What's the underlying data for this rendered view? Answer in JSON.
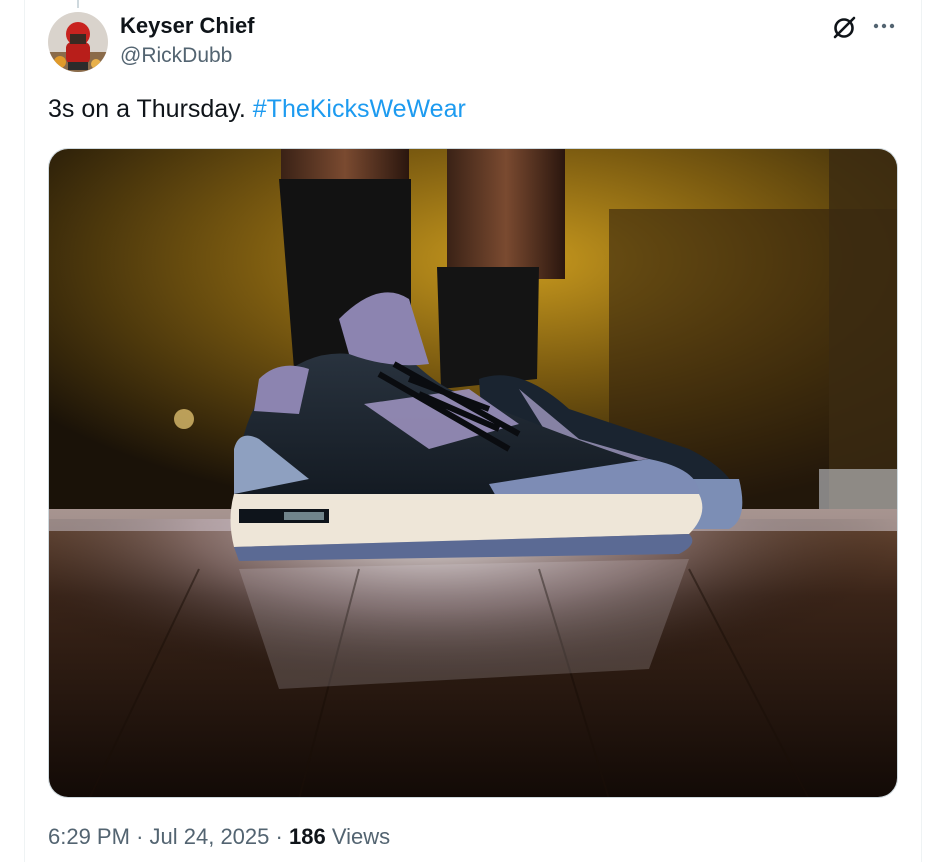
{
  "author": {
    "display_name": "Keyser Chief",
    "handle": "@RickDubb",
    "avatar_icon": "user-avatar"
  },
  "header_actions": {
    "grok_icon": "grok-icon",
    "more_icon": "more-options-icon"
  },
  "tweet": {
    "text": "3s on a Thursday.",
    "hashtag": "#TheKicksWeWear"
  },
  "media": {
    "kind": "photo",
    "subject_icon": "sneaker-photo"
  },
  "meta": {
    "time": "6:29 PM",
    "separator": "·",
    "date": "Jul 24, 2025",
    "views_count": "186",
    "views_label": "Views"
  },
  "colors": {
    "text": "#0f1419",
    "secondary": "#536471",
    "link": "#1d9bf0",
    "border": "#cfd9de"
  }
}
